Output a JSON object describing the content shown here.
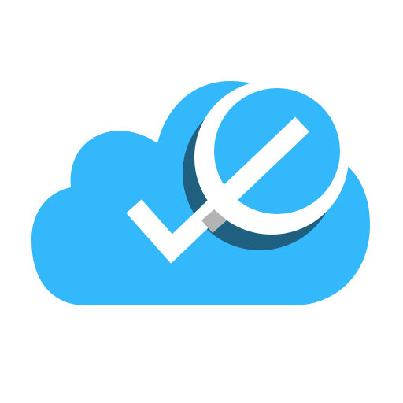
{
  "app_icon": {
    "name": "cloud-check-e-icon",
    "background_color": "#ffffff",
    "cloud_color": "#34b8fc",
    "shadow_color": "#1f5f80",
    "mark_color": "#ffffff",
    "overlap_color": "#b3b3b3"
  }
}
